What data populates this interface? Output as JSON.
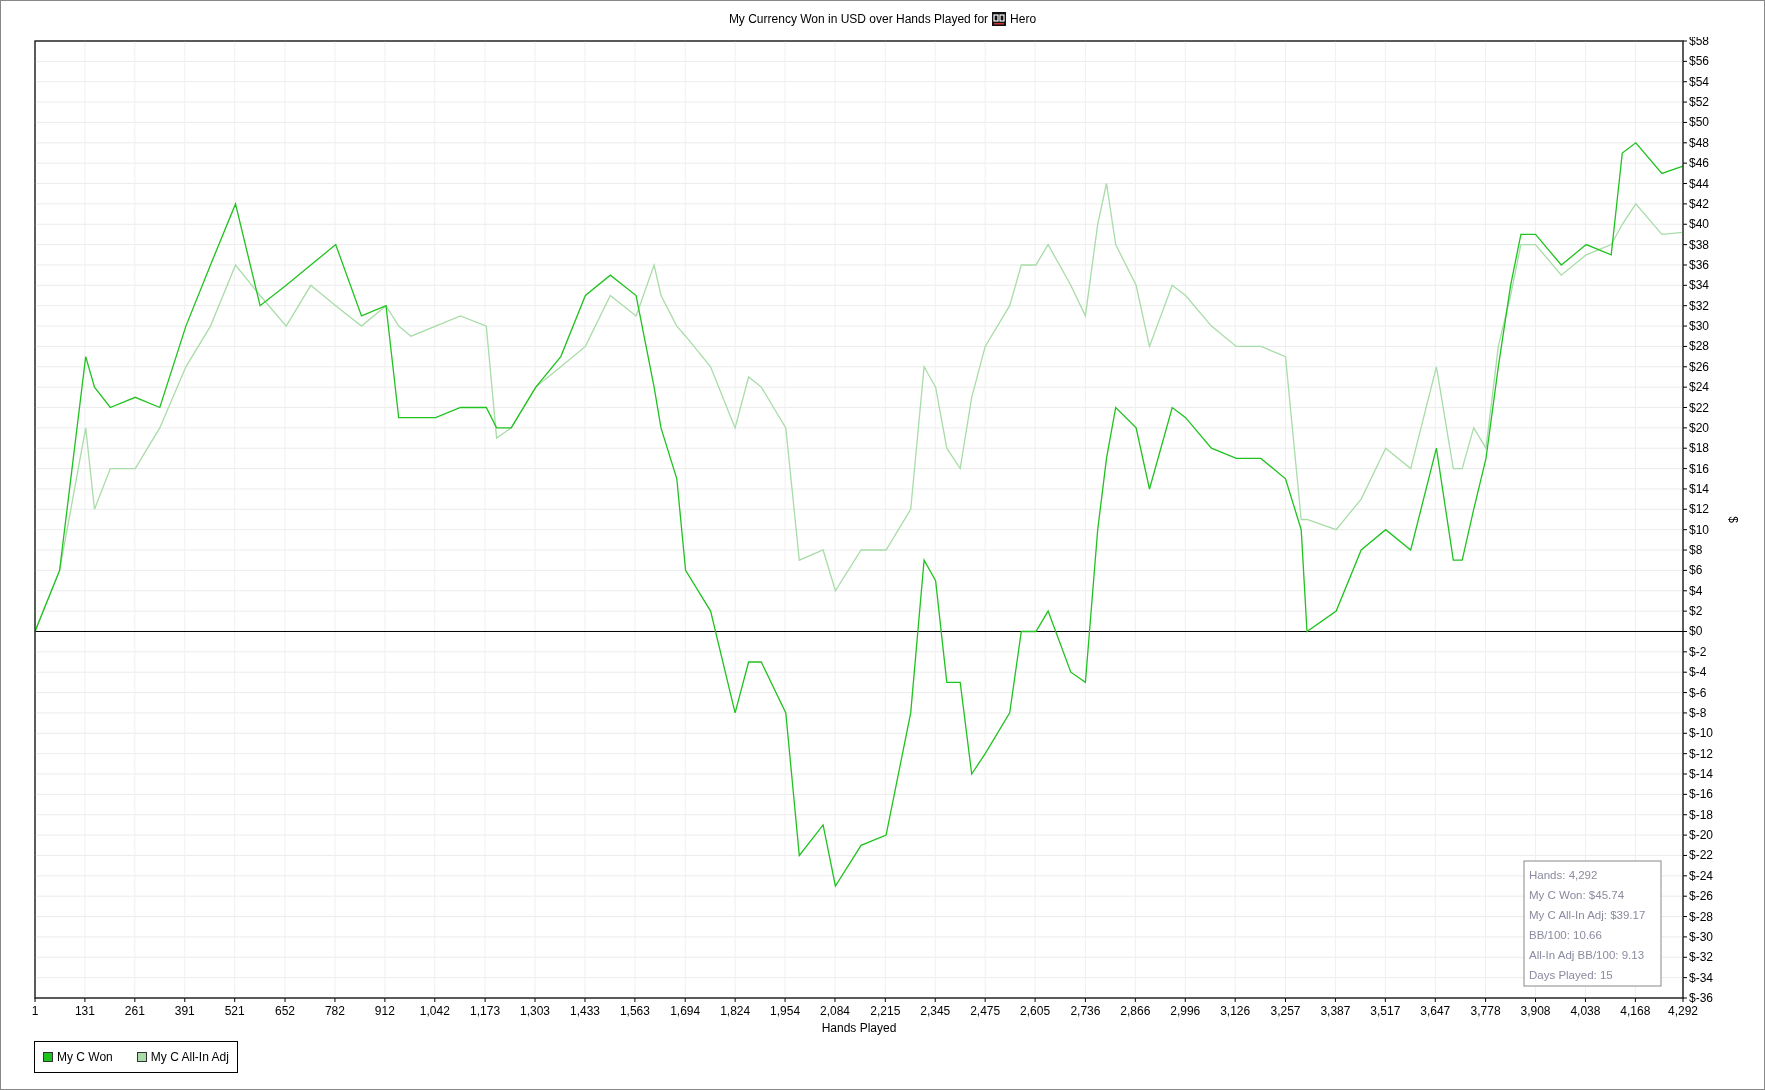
{
  "title": {
    "before": "My Currency Won in USD over Hands Played for",
    "after": "Hero"
  },
  "chart_data": {
    "type": "line",
    "grid": true,
    "xlabel": "Hands Played",
    "ylabel": "$",
    "xlim": [
      1,
      4292
    ],
    "ylim": [
      -36,
      58
    ],
    "x": [
      1,
      65,
      133,
      156,
      197,
      262,
      326,
      394,
      458,
      523,
      587,
      655,
      719,
      784,
      851,
      915,
      948,
      980,
      1044,
      1109,
      1176,
      1203,
      1241,
      1305,
      1370,
      1434,
      1499,
      1566,
      1613,
      1631,
      1672,
      1695,
      1760,
      1824,
      1859,
      1892,
      1956,
      1991,
      2053,
      2085,
      2152,
      2217,
      2281,
      2316,
      2346,
      2375,
      2410,
      2440,
      2475,
      2539,
      2569,
      2607,
      2639,
      2698,
      2736,
      2768,
      2791,
      2815,
      2868,
      2903,
      2962,
      2997,
      3064,
      3129,
      3193,
      3257,
      3298,
      3313,
      3389,
      3454,
      3518,
      3583,
      3650,
      3694,
      3717,
      3747,
      3779,
      3811,
      3843,
      3870,
      3908,
      3975,
      4040,
      4105,
      4134,
      4169,
      4237,
      4292
    ],
    "series": [
      {
        "name": "My C Won",
        "color": "#1fc21f",
        "values": [
          0,
          6,
          27,
          24,
          22,
          23,
          22,
          30,
          36,
          42,
          32,
          34,
          36,
          38,
          31,
          32,
          21,
          21,
          21,
          22,
          22,
          20,
          20,
          24,
          27,
          33,
          35,
          33,
          24,
          20,
          15,
          6,
          2,
          -8,
          -3,
          -3,
          -8,
          -22,
          -19,
          -25,
          -21,
          -20,
          -8,
          7,
          5,
          -5,
          -5,
          -14,
          -12,
          -8,
          0,
          0,
          2,
          -4,
          -5,
          10,
          17,
          22,
          20,
          14,
          22,
          21,
          18,
          17,
          17,
          15,
          10,
          0,
          2,
          8,
          10,
          8,
          18,
          7,
          7,
          12,
          17,
          26,
          34,
          39,
          39,
          36,
          38,
          37,
          47,
          48,
          45,
          45.7
        ]
      },
      {
        "name": "My C All-In Adj",
        "color": "#a8dca8",
        "values": [
          0,
          6,
          20,
          12,
          16,
          16,
          20,
          26,
          30,
          36,
          33,
          30,
          34,
          32,
          30,
          32,
          30,
          29,
          30,
          31,
          30,
          19,
          20,
          24,
          26,
          28,
          33,
          31,
          36,
          33,
          30,
          29,
          26,
          20,
          25,
          24,
          20,
          7,
          8,
          4,
          8,
          8,
          12,
          26,
          24,
          18,
          16,
          23,
          28,
          32,
          36,
          36,
          38,
          34,
          31,
          40,
          44,
          38,
          34,
          28,
          34,
          33,
          30,
          28,
          28,
          27,
          11,
          11,
          10,
          13,
          18,
          16,
          26,
          16,
          16,
          20,
          18,
          28,
          33,
          38,
          38,
          35,
          37,
          38,
          40,
          42,
          39,
          39.2
        ]
      }
    ],
    "xticks": [
      {
        "value": 1,
        "label": "1"
      },
      {
        "value": 131,
        "label": "131"
      },
      {
        "value": 261,
        "label": "261"
      },
      {
        "value": 391,
        "label": "391"
      },
      {
        "value": 521,
        "label": "521"
      },
      {
        "value": 652,
        "label": "652"
      },
      {
        "value": 782,
        "label": "782"
      },
      {
        "value": 912,
        "label": "912"
      },
      {
        "value": 1042,
        "label": "1,042"
      },
      {
        "value": 1173,
        "label": "1,173"
      },
      {
        "value": 1303,
        "label": "1,303"
      },
      {
        "value": 1433,
        "label": "1,433"
      },
      {
        "value": 1563,
        "label": "1,563"
      },
      {
        "value": 1694,
        "label": "1,694"
      },
      {
        "value": 1824,
        "label": "1,824"
      },
      {
        "value": 1954,
        "label": "1,954"
      },
      {
        "value": 2084,
        "label": "2,084"
      },
      {
        "value": 2215,
        "label": "2,215"
      },
      {
        "value": 2345,
        "label": "2,345"
      },
      {
        "value": 2475,
        "label": "2,475"
      },
      {
        "value": 2605,
        "label": "2,605"
      },
      {
        "value": 2736,
        "label": "2,736"
      },
      {
        "value": 2866,
        "label": "2,866"
      },
      {
        "value": 2996,
        "label": "2,996"
      },
      {
        "value": 3126,
        "label": "3,126"
      },
      {
        "value": 3257,
        "label": "3,257"
      },
      {
        "value": 3387,
        "label": "3,387"
      },
      {
        "value": 3517,
        "label": "3,517"
      },
      {
        "value": 3647,
        "label": "3,647"
      },
      {
        "value": 3778,
        "label": "3,778"
      },
      {
        "value": 3908,
        "label": "3,908"
      },
      {
        "value": 4038,
        "label": "4,038"
      },
      {
        "value": 4168,
        "label": "4,168"
      },
      {
        "value": 4292,
        "label": "4,292"
      }
    ],
    "yticks": [
      {
        "value": 58,
        "label": "$58"
      },
      {
        "value": 56,
        "label": "$56"
      },
      {
        "value": 54,
        "label": "$54"
      },
      {
        "value": 52,
        "label": "$52"
      },
      {
        "value": 50,
        "label": "$50"
      },
      {
        "value": 48,
        "label": "$48"
      },
      {
        "value": 46,
        "label": "$46"
      },
      {
        "value": 44,
        "label": "$44"
      },
      {
        "value": 42,
        "label": "$42"
      },
      {
        "value": 40,
        "label": "$40"
      },
      {
        "value": 38,
        "label": "$38"
      },
      {
        "value": 36,
        "label": "$36"
      },
      {
        "value": 34,
        "label": "$34"
      },
      {
        "value": 32,
        "label": "$32"
      },
      {
        "value": 30,
        "label": "$30"
      },
      {
        "value": 28,
        "label": "$28"
      },
      {
        "value": 26,
        "label": "$26"
      },
      {
        "value": 24,
        "label": "$24"
      },
      {
        "value": 22,
        "label": "$22"
      },
      {
        "value": 20,
        "label": "$20"
      },
      {
        "value": 18,
        "label": "$18"
      },
      {
        "value": 16,
        "label": "$16"
      },
      {
        "value": 14,
        "label": "$14"
      },
      {
        "value": 12,
        "label": "$12"
      },
      {
        "value": 10,
        "label": "$10"
      },
      {
        "value": 8,
        "label": "$8"
      },
      {
        "value": 6,
        "label": "$6"
      },
      {
        "value": 4,
        "label": "$4"
      },
      {
        "value": 2,
        "label": "$2"
      },
      {
        "value": 0,
        "label": "$0"
      },
      {
        "value": -2,
        "label": "$-2"
      },
      {
        "value": -4,
        "label": "$-4"
      },
      {
        "value": -6,
        "label": "$-6"
      },
      {
        "value": -8,
        "label": "$-8"
      },
      {
        "value": -10,
        "label": "$-10"
      },
      {
        "value": -12,
        "label": "$-12"
      },
      {
        "value": -14,
        "label": "$-14"
      },
      {
        "value": -16,
        "label": "$-16"
      },
      {
        "value": -18,
        "label": "$-18"
      },
      {
        "value": -20,
        "label": "$-20"
      },
      {
        "value": -22,
        "label": "$-22"
      },
      {
        "value": -24,
        "label": "$-24"
      },
      {
        "value": -26,
        "label": "$-26"
      },
      {
        "value": -28,
        "label": "$-28"
      },
      {
        "value": -30,
        "label": "$-30"
      },
      {
        "value": -32,
        "label": "$-32"
      },
      {
        "value": -34,
        "label": "$-34"
      },
      {
        "value": -36,
        "label": "$-36"
      }
    ]
  },
  "stats": [
    "Hands: 4,292",
    "My C Won: $45.74",
    "My C All-In Adj: $39.17",
    "BB/100: 10.66",
    "All-In Adj BB/100: 9.13",
    "Days Played: 15"
  ]
}
